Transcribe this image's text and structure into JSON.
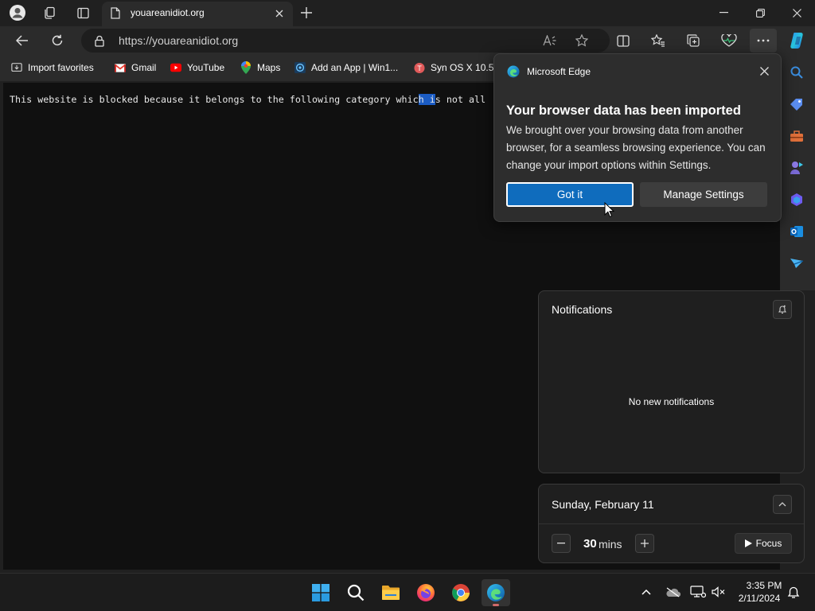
{
  "browser": {
    "tab": {
      "title": "youareanidiot.org",
      "favicon": "page-icon"
    },
    "new_tab": "plus-icon",
    "window_controls": [
      "minimize-icon",
      "restore-icon",
      "close-icon"
    ],
    "address": {
      "url": "https://youareanidiot.org",
      "lock": "lock-icon"
    },
    "favorites": [
      {
        "label": "Import favorites",
        "icon": "import-icon"
      },
      {
        "label": "Gmail",
        "icon": "gmail-icon"
      },
      {
        "label": "YouTube",
        "icon": "youtube-icon"
      },
      {
        "label": "Maps",
        "icon": "maps-pin-icon"
      },
      {
        "label": "Add an App | Win1...",
        "icon": "app-icon"
      },
      {
        "label": "Syn OS X 10.5...",
        "icon": "syn-icon"
      }
    ],
    "sidebar_icons": [
      "search-icon",
      "tag-icon",
      "toolbox-icon",
      "games-icon",
      "office-icon",
      "outlook-icon",
      "send-icon"
    ]
  },
  "page": {
    "text_before": "This website is blocked because it belongs to the following category whic",
    "text_selected": "h i",
    "text_after": "s not all"
  },
  "popup": {
    "app_name": "Microsoft Edge",
    "title": "Your browser data has been imported",
    "body": "We brought over your browsing data from another browser, for a seamless browsing experience. You can change your import options within Settings.",
    "primary_button": "Got it",
    "secondary_button": "Manage Settings"
  },
  "notifications": {
    "title": "Notifications",
    "empty_text": "No new notifications"
  },
  "calendar": {
    "date": "Sunday, February 11",
    "focus_minutes": "30",
    "focus_unit": "mins",
    "focus_button": "Focus"
  },
  "taskbar": {
    "apps": [
      "windows-start-icon",
      "search-icon",
      "file-explorer-icon",
      "firefox-icon",
      "chrome-icon",
      "edge-icon"
    ],
    "time": "3:35 PM",
    "date": "2/11/2024"
  },
  "colors": {
    "accent": "#0f6cbd",
    "selection": "#1b5cc4",
    "background": "#202020"
  }
}
